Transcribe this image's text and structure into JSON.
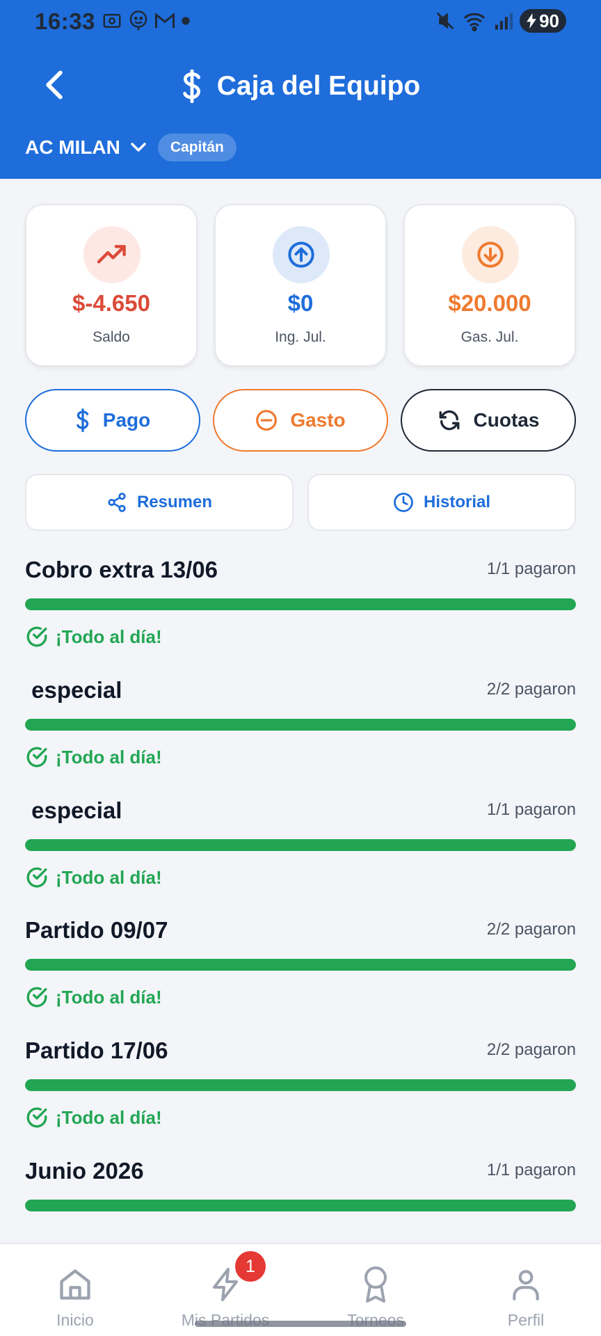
{
  "status": {
    "time": "16:33",
    "battery": "90"
  },
  "header": {
    "title": "Caja del Equipo",
    "team": "AC MILAN",
    "role": "Capitán"
  },
  "stats": [
    {
      "value": "$-4.650",
      "label": "Saldo",
      "color": "#dc4a38"
    },
    {
      "value": "$0",
      "label": "Ing. Jul.",
      "color": "#1e6ddb"
    },
    {
      "value": "$20.000",
      "label": "Gas. Jul.",
      "color": "#ee7a30"
    }
  ],
  "actions": {
    "pago": "Pago",
    "gasto": "Gasto",
    "cuotas": "Cuotas"
  },
  "secondary": {
    "resumen": "Resumen",
    "historial": "Historial"
  },
  "fees": [
    {
      "name": "Cobro extra 13/06",
      "paid": "1/1 pagaron",
      "progress": 1.0,
      "status": "¡Todo al día!"
    },
    {
      "name": " especial",
      "paid": "2/2 pagaron",
      "progress": 1.0,
      "status": "¡Todo al día!"
    },
    {
      "name": " especial",
      "paid": "1/1 pagaron",
      "progress": 1.0,
      "status": "¡Todo al día!"
    },
    {
      "name": "Partido 09/07",
      "paid": "2/2 pagaron",
      "progress": 1.0,
      "status": "¡Todo al día!"
    },
    {
      "name": "Partido 17/06",
      "paid": "2/2 pagaron",
      "progress": 1.0,
      "status": "¡Todo al día!"
    },
    {
      "name": "Junio 2026",
      "paid": "1/1 pagaron",
      "progress": 1.0,
      "status": ""
    }
  ],
  "nav": {
    "inicio": "Inicio",
    "mis_partidos": "Mis Partidos",
    "torneos": "Torneos",
    "perfil": "Perfil",
    "badge": "1"
  },
  "colors": {
    "primary": "#1e6ddb",
    "success": "#22a653",
    "danger": "#dc4a38",
    "warning": "#ee7a30"
  }
}
